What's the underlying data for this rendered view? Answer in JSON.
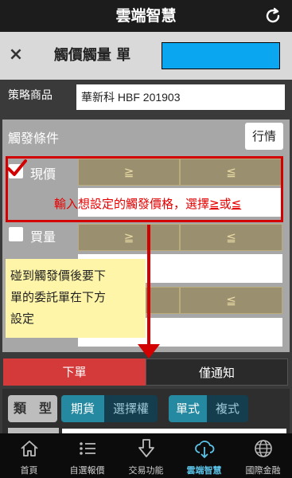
{
  "app": {
    "title": "雲端智慧"
  },
  "header": {
    "title": "觸價觸量 單",
    "close_symbol": "×"
  },
  "strategy": {
    "label": "策略商品",
    "value": "華新科 HBF 201903"
  },
  "trigger": {
    "title": "觸發條件",
    "quote_button": "行情",
    "rows": [
      {
        "label": "現價",
        "checked": true,
        "gte": "≧",
        "lte": "≦"
      },
      {
        "label": "買量",
        "checked": false,
        "gte": "≧",
        "lte": "≦"
      },
      {
        "gte": "",
        "lte": "≦"
      }
    ]
  },
  "annotations": {
    "red_hint_prefix": "輸入想設定的觸發價格，選擇",
    "red_hint_gte": "≧",
    "red_hint_or": "或",
    "red_hint_lte": "≦",
    "note_line1": "碰到觸發價後要下",
    "note_line2": "單的委託單在下方",
    "note_line3": "設定"
  },
  "tabs": {
    "order": "下單",
    "notify": "僅通知"
  },
  "order_type": {
    "label": "類　型",
    "product": [
      "期貨",
      "選擇權"
    ],
    "style": [
      "單式",
      "複式"
    ]
  },
  "nav": [
    {
      "label": "首頁",
      "icon": "home-icon"
    },
    {
      "label": "自選報價",
      "icon": "list-icon"
    },
    {
      "label": "交易功能",
      "icon": "download-arrow-icon"
    },
    {
      "label": "雲端智慧",
      "icon": "cloud-download-icon",
      "active": true
    },
    {
      "label": "國際金融",
      "icon": "globe-icon"
    }
  ],
  "colors": {
    "accent_red": "#d20000",
    "active_tab": "#d53a3a",
    "nav_active": "#5bc3e8",
    "segment_on": "#2589a1",
    "header_blue": "#0aa6ef"
  }
}
